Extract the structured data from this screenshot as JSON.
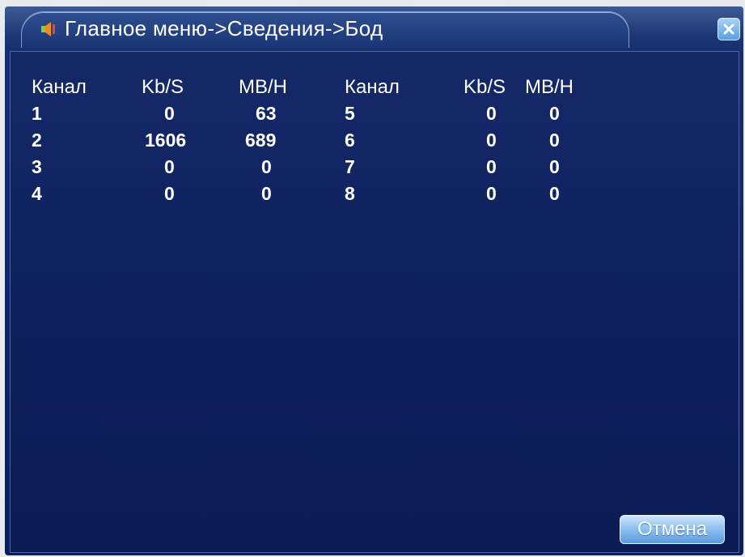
{
  "window": {
    "title": "Главное меню->Сведения->Бод"
  },
  "table": {
    "headers": [
      "Канал",
      "Kb/S",
      "MB/H",
      "Канал",
      "Kb/S",
      "MB/H"
    ],
    "rows": [
      [
        "1",
        "0",
        "63",
        "5",
        "0",
        "0"
      ],
      [
        "2",
        "1606",
        "689",
        "6",
        "0",
        "0"
      ],
      [
        "3",
        "0",
        "0",
        "7",
        "0",
        "0"
      ],
      [
        "4",
        "0",
        "0",
        "8",
        "0",
        "0"
      ]
    ]
  },
  "buttons": {
    "cancel_label": "Отмена"
  },
  "icons": {
    "title_icon": "speaker-icon",
    "close_icon": "close-icon"
  },
  "colors": {
    "background": "#122463",
    "text": "#ffffff",
    "accent": "#5a9fe1"
  }
}
